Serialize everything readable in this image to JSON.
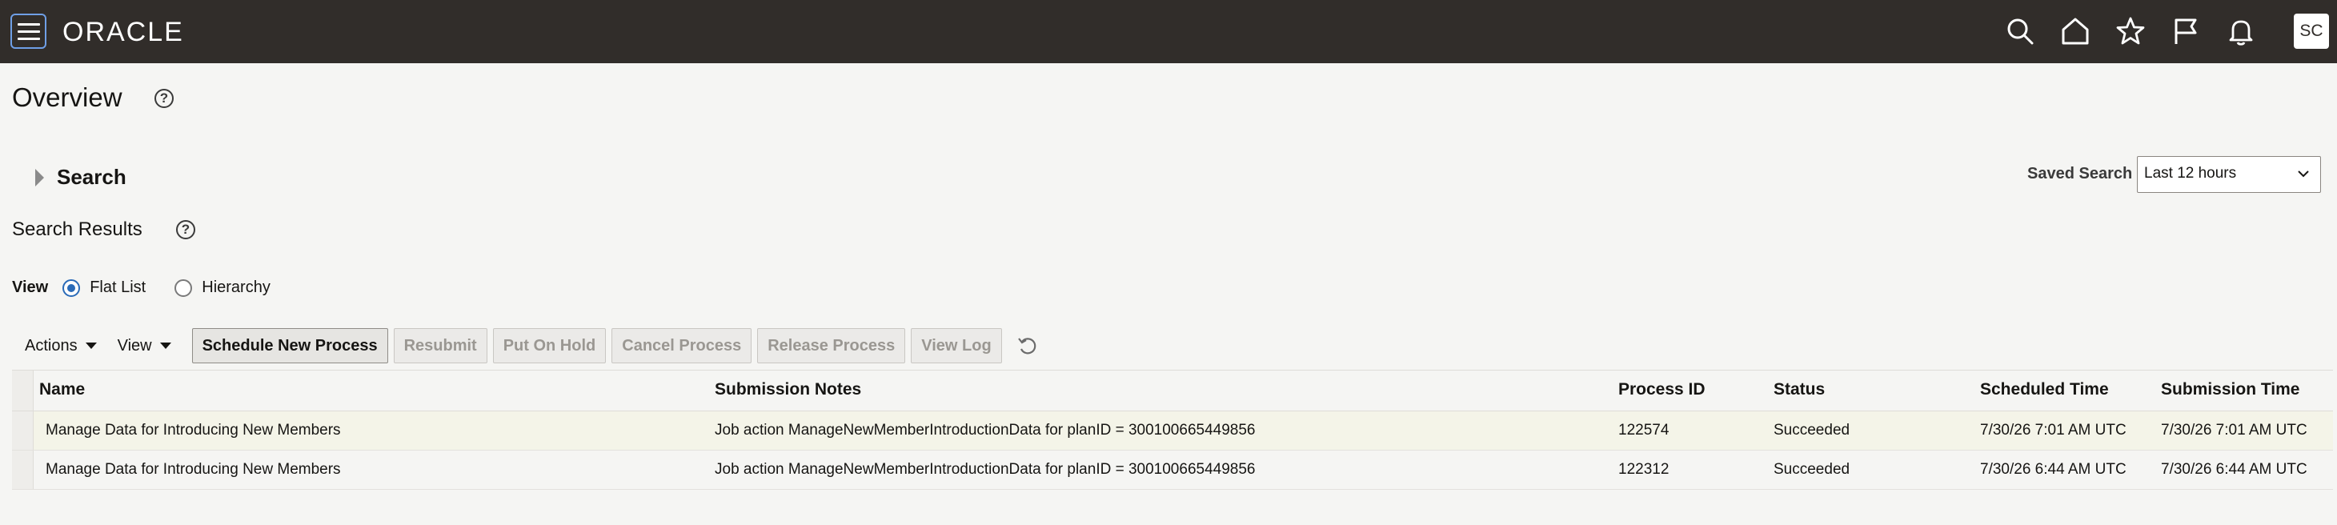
{
  "app": {
    "logo_text": "ORACLE",
    "user_initials": "SC"
  },
  "topbar": {
    "icons": [
      "search-icon",
      "home-icon",
      "favorites-star-icon",
      "flag-icon",
      "notifications-bell-icon"
    ]
  },
  "page": {
    "title": "Overview"
  },
  "search": {
    "label": "Search",
    "saved_label": "Saved Search",
    "saved_value": "Last 12 hours"
  },
  "results": {
    "title": "Search Results",
    "view_label": "View",
    "view_options": [
      "Flat List",
      "Hierarchy"
    ],
    "selected_view": "Flat List"
  },
  "toolbar": {
    "actions_label": "Actions",
    "view_label": "View",
    "schedule_label": "Schedule New Process",
    "resubmit_label": "Resubmit",
    "hold_label": "Put On Hold",
    "cancel_label": "Cancel Process",
    "release_label": "Release Process",
    "viewlog_label": "View Log"
  },
  "table": {
    "columns": [
      "Name",
      "Submission Notes",
      "Process ID",
      "Status",
      "Scheduled Time",
      "Submission Time"
    ],
    "rows": [
      {
        "name": "Manage Data for Introducing New Members",
        "notes": "Job action ManageNewMemberIntroductionData for planID = 300100665449856",
        "process_id": "122574",
        "status": "Succeeded",
        "scheduled": "7/30/26 7:01 AM UTC",
        "submitted": "7/30/26 7:01 AM UTC"
      },
      {
        "name": "Manage Data for Introducing New Members",
        "notes": "Job action ManageNewMemberIntroductionData for planID = 300100665449856",
        "process_id": "122312",
        "status": "Succeeded",
        "scheduled": "7/30/26 6:44 AM UTC",
        "submitted": "7/30/26 6:44 AM UTC"
      }
    ]
  }
}
